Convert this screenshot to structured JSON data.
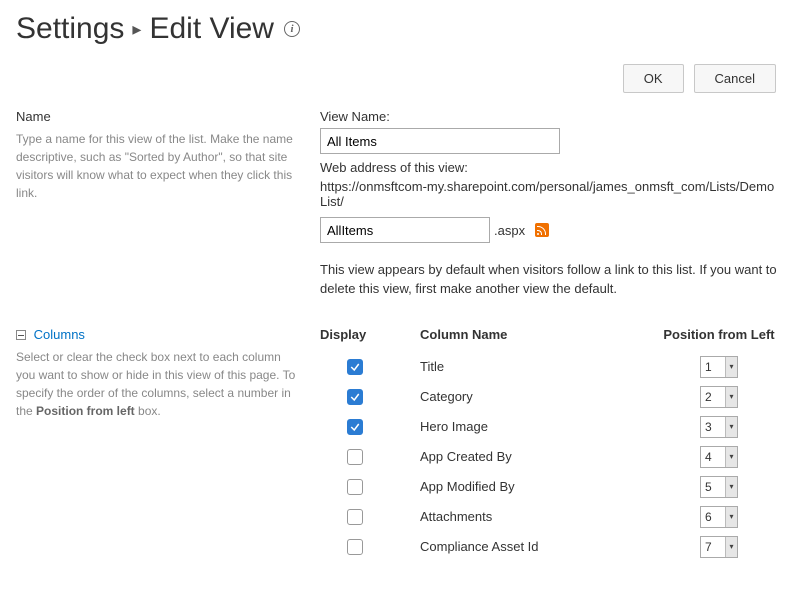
{
  "header": {
    "crumb": "Settings",
    "title": "Edit View"
  },
  "buttons": {
    "ok": "OK",
    "cancel": "Cancel"
  },
  "name_section": {
    "title": "Name",
    "help": "Type a name for this view of the list. Make the name descriptive, such as \"Sorted by Author\", so that site visitors will know what to expect when they click this link.",
    "view_name_label": "View Name:",
    "view_name_value": "All Items",
    "web_address_label": "Web address of this view:",
    "web_address_prefix": "https://onmsftcom-my.sharepoint.com/personal/james_onmsft_com/Lists/Demo List/",
    "url_input_value": "AllItems",
    "url_suffix": ".aspx",
    "default_note": "This view appears by default when visitors follow a link to this list. If you want to delete this view, first make another view the default."
  },
  "columns_section": {
    "title": "Columns",
    "help_pre": "Select or clear the check box next to each column you want to show or hide in this view of this page. To specify the order of the columns, select a number in the ",
    "help_bold": "Position from left",
    "help_post": " box.",
    "head_display": "Display",
    "head_name": "Column Name",
    "head_pos": "Position from Left",
    "rows": [
      {
        "checked": true,
        "name": "Title",
        "pos": "1"
      },
      {
        "checked": true,
        "name": "Category",
        "pos": "2"
      },
      {
        "checked": true,
        "name": "Hero Image",
        "pos": "3"
      },
      {
        "checked": false,
        "name": "App Created By",
        "pos": "4"
      },
      {
        "checked": false,
        "name": "App Modified By",
        "pos": "5"
      },
      {
        "checked": false,
        "name": "Attachments",
        "pos": "6"
      },
      {
        "checked": false,
        "name": "Compliance Asset Id",
        "pos": "7"
      }
    ]
  }
}
